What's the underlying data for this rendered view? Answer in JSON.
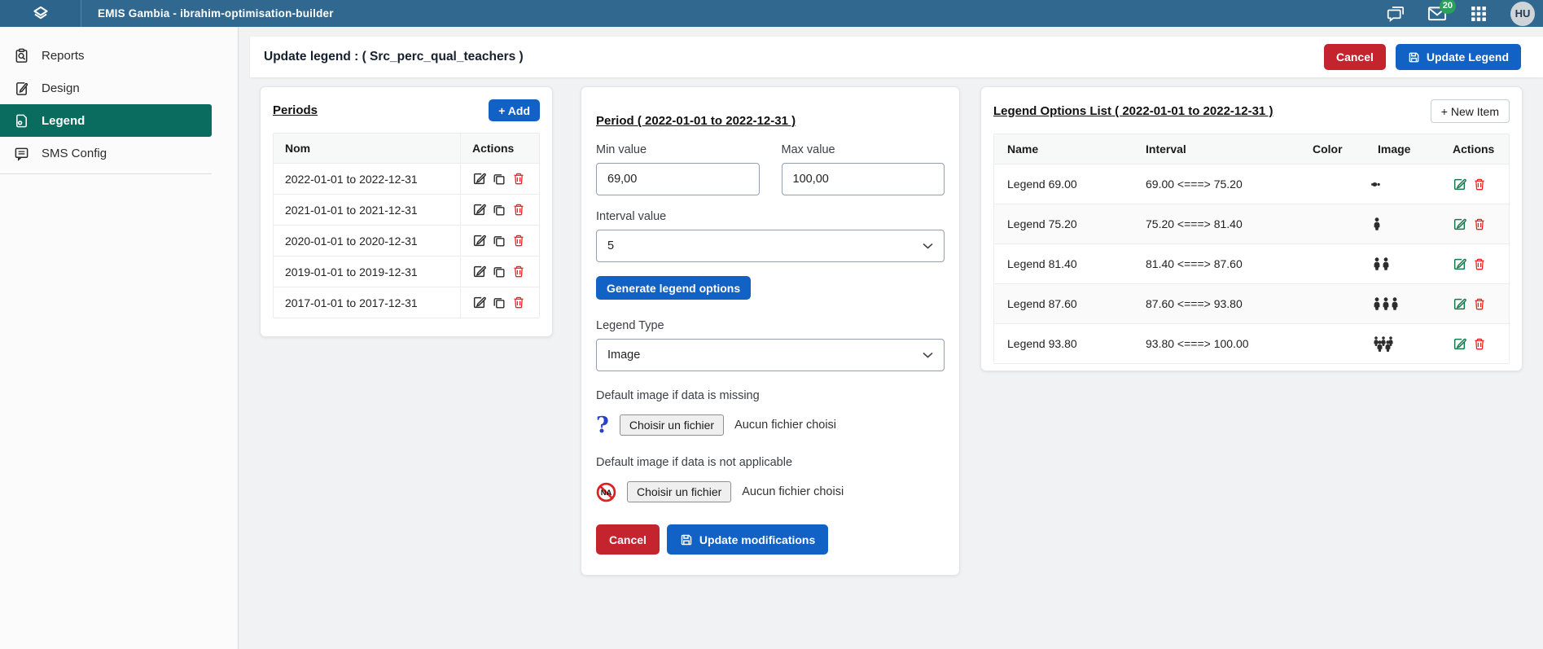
{
  "topbar": {
    "title": "EMIS Gambia - ibrahim-optimisation-builder",
    "badge_count": "20",
    "avatar_initials": "HU"
  },
  "sidebar": {
    "items": [
      {
        "label": "Reports"
      },
      {
        "label": "Design"
      },
      {
        "label": "Legend"
      },
      {
        "label": "SMS Config"
      }
    ]
  },
  "page_header": {
    "title": "Update legend : ( Src_perc_qual_teachers )",
    "cancel_label": "Cancel",
    "update_label": "Update Legend"
  },
  "periods": {
    "title": "Periods",
    "add_label": "+ Add",
    "col_name": "Nom",
    "col_actions": "Actions",
    "rows": [
      {
        "name": "2022-01-01 to 2022-12-31"
      },
      {
        "name": "2021-01-01 to 2021-12-31"
      },
      {
        "name": "2020-01-01 to 2020-12-31"
      },
      {
        "name": "2019-01-01 to 2019-12-31"
      },
      {
        "name": "2017-01-01 to 2017-12-31"
      }
    ]
  },
  "editor": {
    "title": "Period ( 2022-01-01 to 2022-12-31 )",
    "min_label": "Min value",
    "min_value": "69,00",
    "max_label": "Max value",
    "max_value": "100,00",
    "interval_label": "Interval value",
    "interval_value": "5",
    "generate_label": "Generate legend options",
    "legend_type_label": "Legend Type",
    "legend_type_value": "Image",
    "missing_image_label": "Default image if data is missing",
    "na_image_label": "Default image if data is not applicable",
    "file_button_label": "Choisir un fichier",
    "file_status_label": "Aucun fichier choisi",
    "missing_icon_glyph": "?",
    "na_icon_text": "NA",
    "cancel_label": "Cancel",
    "update_label": "Update modifications"
  },
  "legend_options": {
    "title": "Legend Options List ( 2022-01-01 to 2022-12-31 )",
    "new_item_label": "+ New Item",
    "columns": [
      "Name",
      "Interval",
      "Color",
      "Image",
      "Actions"
    ],
    "rows": [
      {
        "name": "Legend 69.00",
        "interval": "69.00 <===> 75.20",
        "persons": 1,
        "variant": "xs"
      },
      {
        "name": "Legend 75.20",
        "interval": "75.20 <===> 81.40",
        "persons": 1,
        "variant": "sm"
      },
      {
        "name": "Legend 81.40",
        "interval": "81.40 <===> 87.60",
        "persons": 2,
        "variant": "sm"
      },
      {
        "name": "Legend 87.60",
        "interval": "87.60 <===> 93.80",
        "persons": 3,
        "variant": "sm"
      },
      {
        "name": "Legend 93.80",
        "interval": "93.80 <===> 100.00",
        "persons": 5,
        "variant": "cluster"
      }
    ]
  },
  "colors": {
    "topbar": "#30688f",
    "active_nav": "#0a6c5e",
    "primary_button": "#1261c4",
    "danger_button": "#c3242e",
    "badge": "#2aa05a",
    "edit_icon_green": "#14794a",
    "delete_icon_red": "#ee2222"
  }
}
